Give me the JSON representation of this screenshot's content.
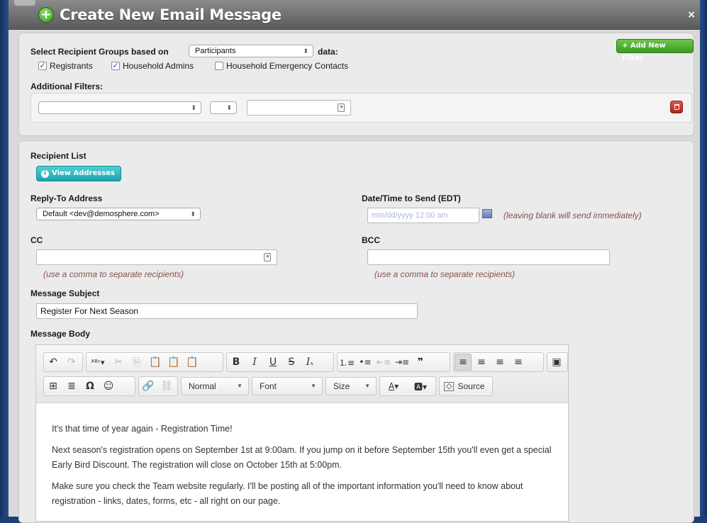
{
  "dialog": {
    "title": "Create New Email Message",
    "close_label": "×"
  },
  "filters": {
    "group_label": "Select Recipient Groups based on",
    "group_select_value": "Participants",
    "group_suffix": "data:",
    "add_filter_label": "+ Add New Filter",
    "checkboxes": [
      {
        "label": "Registrants",
        "checked": true
      },
      {
        "label": "Household Admins",
        "checked": true
      },
      {
        "label": "Household Emergency Contacts",
        "checked": false
      }
    ],
    "additional_label": "Additional Filters:",
    "filter_select_1": "",
    "filter_select_2": "",
    "filter_value": ""
  },
  "recipients": {
    "list_label": "Recipient List",
    "view_button_label": "View Addresses"
  },
  "reply_to": {
    "label": "Reply-To Address",
    "value": "Default <dev@demosphere.com>"
  },
  "send_time": {
    "label": "Date/Time to Send (EDT)",
    "placeholder": "mm/dd/yyyy 12:00 am",
    "hint": "(leaving blank will send immediately)"
  },
  "cc": {
    "label": "CC",
    "value": "",
    "hint": "(use a comma to separate recipients)"
  },
  "bcc": {
    "label": "BCC",
    "value": "",
    "hint": "(use a comma to separate recipients)"
  },
  "subject": {
    "label": "Message Subject",
    "value": "Register For Next Season"
  },
  "body": {
    "label": "Message Body",
    "toolbar": {
      "format_value": "Normal",
      "font_value": "Font",
      "size_value": "Size",
      "source_label": "Source"
    },
    "paragraphs": [
      "It's that time of year again - Registration Time!",
      "Next season's registration opens on September 1st at 9:00am. If you jump on it before September 15th you'll even get a special Early Bird Discount. The registration will close on October 15th at 5:00pm.",
      "Make sure you check the Team website regularly. I'll be posting all of the important information you'll need to know about registration - links, dates, forms, etc - all right on our page."
    ]
  },
  "colors": {
    "background": "#1d3f73",
    "titlebar": "#6e6e6e",
    "green_button": "#4caf2d",
    "teal_button": "#28b2bb",
    "delete_button": "#c9362b",
    "hint_text": "#8a4f4f"
  }
}
